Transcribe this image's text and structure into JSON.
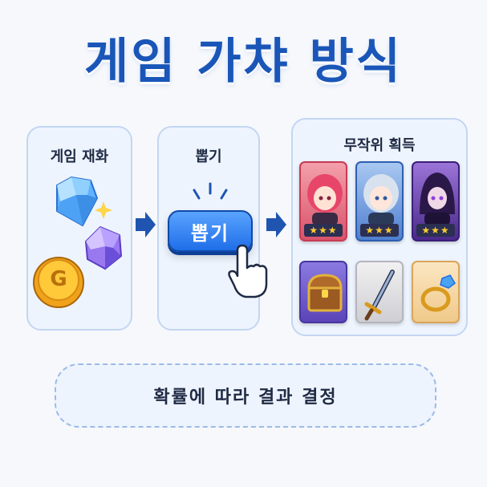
{
  "title": "게임 가챠 방식",
  "steps": {
    "currency": {
      "label": "게임 재화",
      "coin_letter": "G"
    },
    "draw": {
      "label": "뽑기",
      "button_label": "뽑기"
    },
    "result": {
      "label": "무작위 획득",
      "characters": [
        {
          "name": "pink-hair-character",
          "rarity": "★★★",
          "bg": "#e86a7a"
        },
        {
          "name": "silver-hair-character",
          "rarity": "★★★",
          "bg": "#5b8fd9"
        },
        {
          "name": "hooded-character",
          "rarity": "★★★",
          "bg": "#6a3fae"
        }
      ],
      "items": [
        "treasure-chest",
        "sword",
        "ring"
      ]
    }
  },
  "footer": "확률에 따라 결과 결정",
  "colors": {
    "title": "#1a56b8",
    "arrow": "#1f55b0",
    "panel_bg": "#eef4fd",
    "panel_border": "#c3d6f2"
  }
}
